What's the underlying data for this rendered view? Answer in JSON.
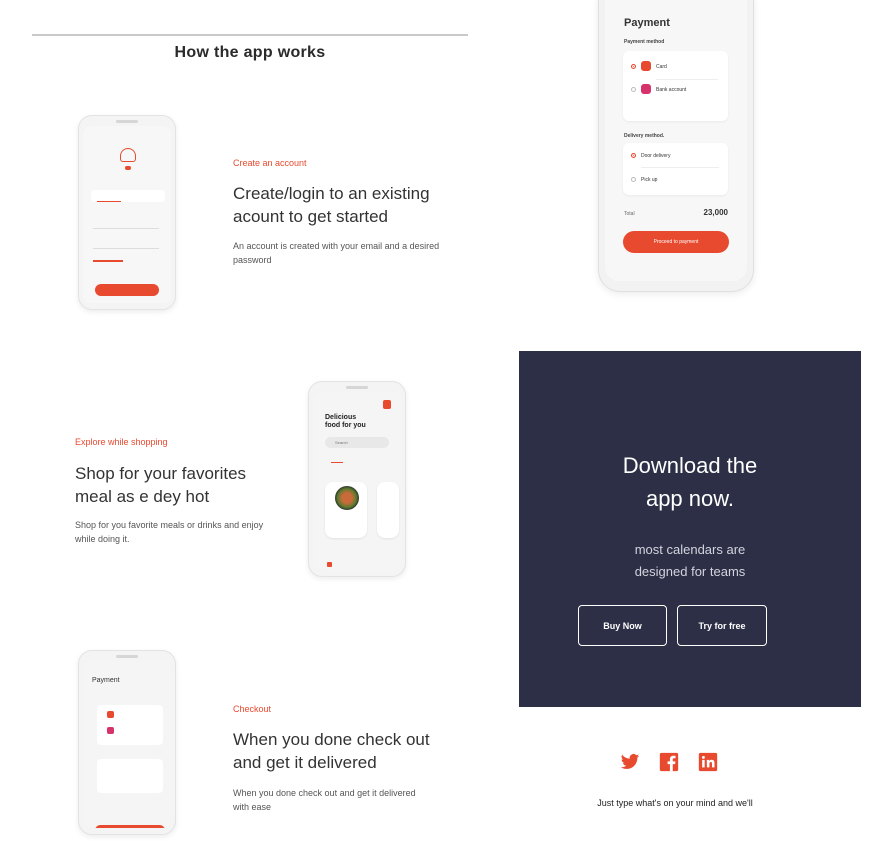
{
  "section_title": "How the app works",
  "steps": [
    {
      "tag": "Create an account",
      "heading": "Create/login to an existing acount to get started",
      "description": "An account is created with your email and a desired password"
    },
    {
      "tag": "Explore while shopping",
      "heading": "Shop for your favorites meal as e dey hot",
      "description": "Shop for you favorite meals or drinks and enjoy while doing it."
    },
    {
      "tag": "Checkout",
      "heading": "When you done check out and get it delivered",
      "description": "When you done check out and get it delivered with ease"
    }
  ],
  "phone_food": {
    "headline_1": "Delicious",
    "headline_2": "food for you",
    "search_placeholder": "Search"
  },
  "payment_mockup": {
    "title": "Payment",
    "payment_method_label": "Payment method",
    "options": [
      "Card",
      "Bank account"
    ],
    "delivery_method_label": "Delivery method.",
    "delivery_options": [
      "Door delivery",
      "Pick up"
    ],
    "total_label": "Total",
    "total_value": "23,000",
    "proceed_label": "Proceed to payment"
  },
  "download": {
    "title_line_1": "Download the",
    "title_line_2": "app now.",
    "subtitle_line_1": "most calendars are",
    "subtitle_line_2": "designed for teams",
    "buy_label": "Buy Now",
    "try_label": "Try for free"
  },
  "footer": {
    "tagline": "Just type what's on your mind and we'll"
  },
  "colors": {
    "accent": "#e84a2f",
    "panel": "#2c2f45"
  }
}
